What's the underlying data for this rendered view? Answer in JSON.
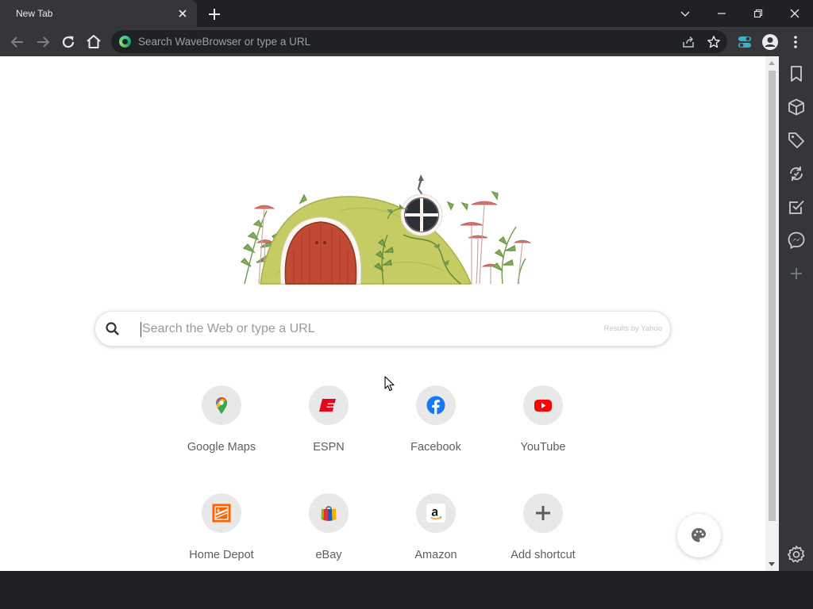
{
  "tab": {
    "title": "New Tab"
  },
  "omnibox": {
    "placeholder": "Search WaveBrowser or type a URL"
  },
  "search": {
    "placeholder": "Search the Web or type a URL",
    "powered_by": "Results by Yahoo"
  },
  "shortcuts": [
    {
      "label": "Google Maps",
      "icon": "google-maps-icon"
    },
    {
      "label": "ESPN",
      "icon": "espn-icon"
    },
    {
      "label": "Facebook",
      "icon": "facebook-icon"
    },
    {
      "label": "YouTube",
      "icon": "youtube-icon"
    },
    {
      "label": "Home Depot",
      "icon": "home-depot-icon"
    },
    {
      "label": "eBay",
      "icon": "ebay-icon"
    },
    {
      "label": "Amazon",
      "icon": "amazon-icon"
    },
    {
      "label": "Add shortcut",
      "icon": "plus-icon"
    }
  ],
  "sidebar": [
    {
      "name": "bookmark-icon"
    },
    {
      "name": "package-icon"
    },
    {
      "name": "tag-icon"
    },
    {
      "name": "sync-icon"
    },
    {
      "name": "checklist-icon"
    },
    {
      "name": "messenger-icon"
    },
    {
      "name": "add-icon"
    },
    {
      "name": "settings-icon"
    }
  ],
  "colors": {
    "chrome_dark": "#202124",
    "toolbar": "#35363a",
    "espn_red": "#e3061b",
    "facebook_blue": "#1877f2",
    "youtube_red": "#ff0000",
    "home_depot_orange": "#f96302"
  }
}
